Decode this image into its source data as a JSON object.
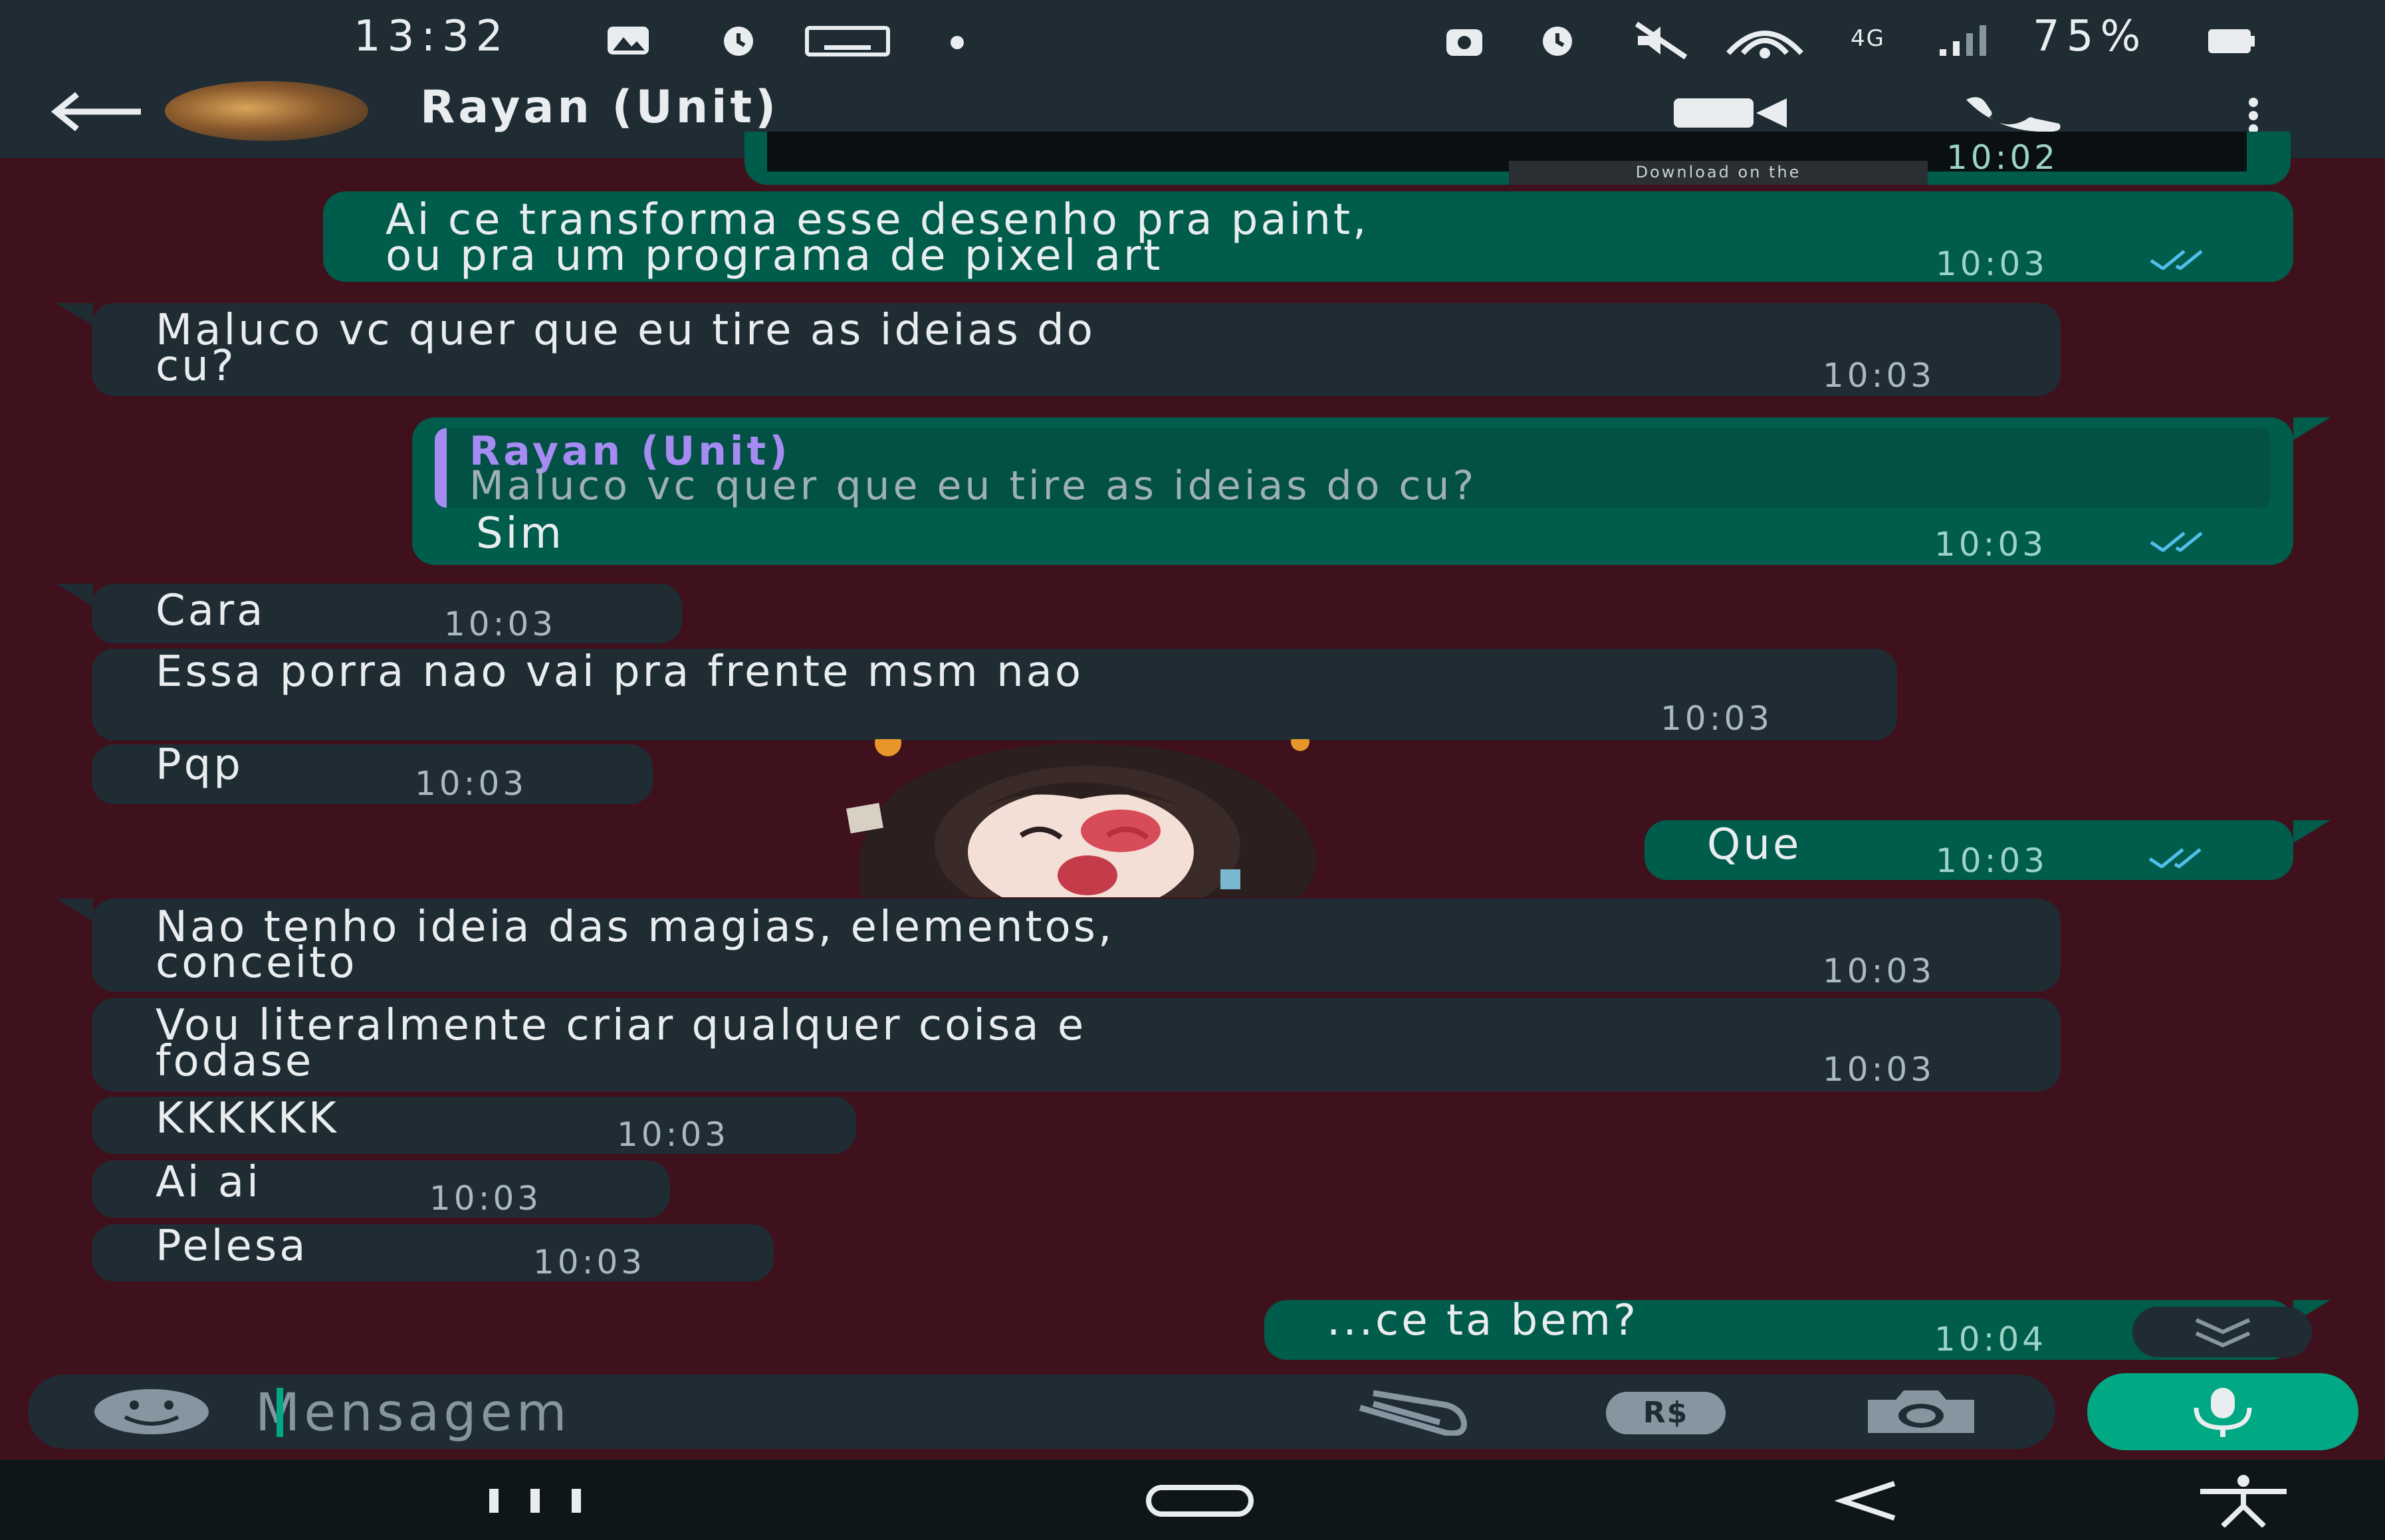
{
  "status_bar": {
    "time": "13:32",
    "battery": "75%",
    "network": "4G",
    "icons": [
      "gallery-icon",
      "alarm-icon",
      "keyboard-icon",
      "dot-icon",
      "lock-icon",
      "alarm-icon",
      "mute-icon",
      "hotspot-icon",
      "signal-icon",
      "battery-icon"
    ]
  },
  "header": {
    "contact_name": "Rayan (Unit)",
    "actions": [
      "back-arrow-icon",
      "video-call-icon",
      "voice-call-icon",
      "more-options-icon"
    ]
  },
  "partial_top": {
    "time": "10:02",
    "caption": "Download on the"
  },
  "messages": [
    {
      "dir": "out",
      "text": "Ai ce transforma esse desenho pra paint,\nou pra um programa de pixel art",
      "time": "10:03",
      "read": true
    },
    {
      "dir": "in",
      "text": "Maluco vc quer que eu tire as ideias do\ncu?",
      "time": "10:03"
    },
    {
      "dir": "out",
      "quote": {
        "author": "Rayan (Unit)",
        "text": "Maluco vc quer que eu tire as ideias do cu?"
      },
      "text": "Sim",
      "time": "10:03",
      "read": true
    },
    {
      "dir": "in",
      "text": "Cara",
      "time": "10:03"
    },
    {
      "dir": "in",
      "text": "Essa porra nao vai pra frente msm nao",
      "time": "10:03"
    },
    {
      "dir": "in",
      "text": "Pqp",
      "time": "10:03"
    },
    {
      "dir": "out",
      "text": "Que",
      "time": "10:03",
      "read": true
    },
    {
      "dir": "in",
      "text": "Nao tenho ideia das magias, elementos,\nconceito",
      "time": "10:03"
    },
    {
      "dir": "in",
      "text": "Vou literalmente criar qualquer coisa e\nfodase",
      "time": "10:03"
    },
    {
      "dir": "in",
      "text": "KKKKKK",
      "time": "10:03"
    },
    {
      "dir": "in",
      "text": "Ai ai",
      "time": "10:03"
    },
    {
      "dir": "in",
      "text": "Pelesa",
      "time": "10:03"
    },
    {
      "dir": "out",
      "text": "...ce ta bem?",
      "time": "10:04",
      "read": true
    }
  ],
  "sticker": {
    "name": "anime-girl-sticker"
  },
  "input_bar": {
    "placeholder": "Mensagem",
    "icons": [
      "emoji-icon",
      "attach-icon",
      "payment-icon",
      "camera-icon",
      "mic-icon"
    ],
    "payment_label": "R$"
  },
  "nav_bar": {
    "icons": [
      "recents-icon",
      "home-icon",
      "back-icon",
      "accessibility-icon"
    ]
  },
  "colors": {
    "wallpaper": "#3f111c",
    "bar": "#1f2c34",
    "incoming": "#1f2c34",
    "outgoing": "#005c4b",
    "accent": "#00a884",
    "read_ticks": "#53bdeb",
    "quote_author": "#a68cf2"
  }
}
